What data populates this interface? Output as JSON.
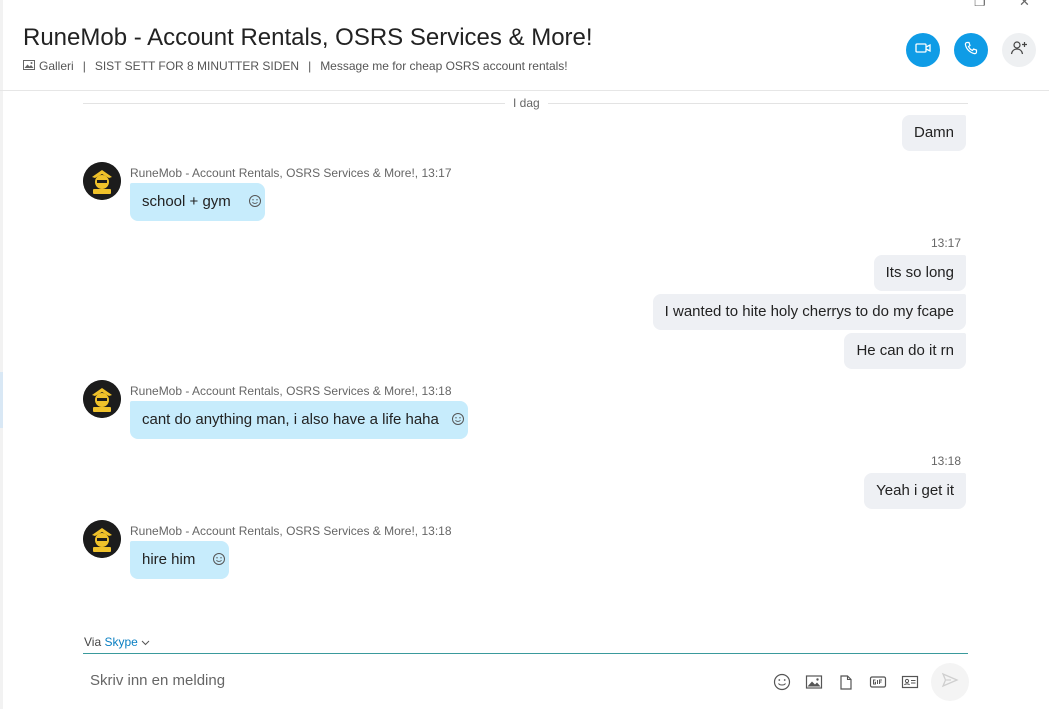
{
  "header": {
    "title": "RuneMob - Account Rentals, OSRS Services & More!",
    "gallery_label": "Galleri",
    "last_seen": "SIST SETT FOR 8 MINUTTER SIDEN",
    "mood": "Message me for cheap OSRS account rentals!"
  },
  "day_label": "I dag",
  "contact_name": "RuneMob - Account Rentals, OSRS Services & More!,",
  "messages": {
    "out_damn": "Damn",
    "in1": {
      "time": "13:17",
      "text": "school + gym"
    },
    "out_time1": "13:17",
    "out_long": "Its so long",
    "out_cherrys": "I wanted to hite holy cherrys to do my fcape",
    "out_rn": "He can do it rn",
    "in2": {
      "time": "13:18",
      "text": "cant do anything man, i also have a life haha"
    },
    "out_time2": "13:18",
    "out_getit": "Yeah i get it",
    "in3": {
      "time": "13:18",
      "text": "hire him"
    }
  },
  "compose": {
    "via": "Via",
    "via_service": "Skype",
    "placeholder": "Skriv inn en melding"
  },
  "colors": {
    "accent": "#0f9ce6",
    "incoming_bubble": "#c7ecfc",
    "outgoing_bubble": "#eef0f4",
    "compose_line": "#3a9a9c",
    "link": "#0a7fc2"
  },
  "icons": [
    "gallery-icon",
    "video-call-icon",
    "audio-call-icon",
    "add-person-icon",
    "reaction-icon",
    "emoji-icon",
    "image-icon",
    "file-icon",
    "gif-icon",
    "contact-card-icon",
    "send-icon",
    "chevron-down-icon",
    "restore-icon",
    "close-icon"
  ]
}
